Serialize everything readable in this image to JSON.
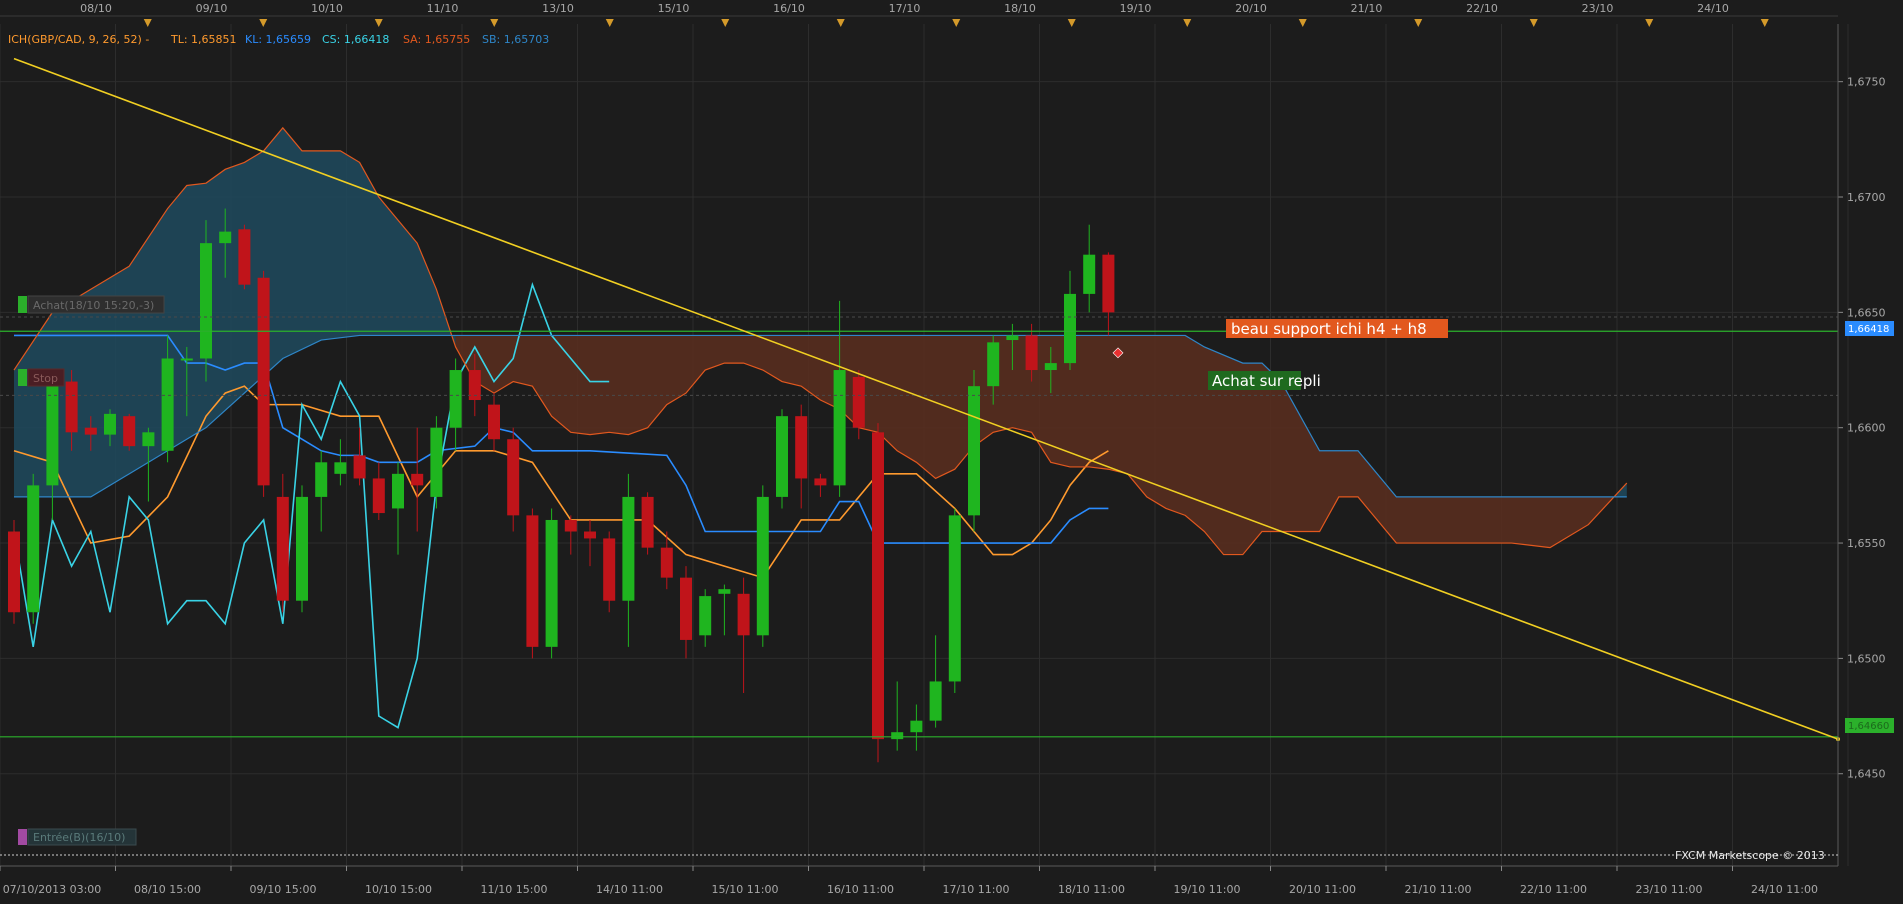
{
  "header": {
    "indicator_name": "ICH(GBP/CAD, 9, 26, 52) -",
    "tl": "TL: 1,65851",
    "kl": "KL: 1,65659",
    "cs": "CS: 1,66418",
    "sa": "SA: 1,65755",
    "sb": "SB: 1,65703"
  },
  "colors": {
    "background": "#1c1c1c",
    "grid": "#2d2d2d",
    "tenkan": "#ff9a2e",
    "kijun": "#2a8cff",
    "chikou": "#39d3e6",
    "senkou_a": "#e2581e",
    "senkou_b": "#2e86c8",
    "kumo_bull": "#1f4a5e",
    "kumo_bear": "#5a2e1e",
    "candle_up": "#1fb51f",
    "candle_down": "#c0141a",
    "trendline": "#f1cf22",
    "support": "#2bb02b"
  },
  "top_dates": [
    "08/10",
    "09/10",
    "10/10",
    "11/10",
    "13/10",
    "15/10",
    "16/10",
    "17/10",
    "18/10",
    "19/10",
    "20/10",
    "21/10",
    "22/10",
    "23/10",
    "24/10"
  ],
  "bottom_dates": [
    "07/10/2013 03:00",
    "08/10 15:00",
    "09/10 15:00",
    "10/10 15:00",
    "11/10 15:00",
    "14/10 11:00",
    "15/10 11:00",
    "16/10 11:00",
    "17/10 11:00",
    "18/10 11:00",
    "19/10 11:00",
    "20/10 11:00",
    "21/10 11:00",
    "22/10 11:00",
    "23/10 11:00",
    "24/10 11:00"
  ],
  "price_labels": [
    "1,6750",
    "1,6700",
    "1,6650",
    "1,6600",
    "1,6550",
    "1,6500",
    "1,6450"
  ],
  "price_tags": {
    "upper": "1,66418",
    "lower": "1,64660"
  },
  "orders": {
    "buy": "Achat(18/10 15:20,-3)",
    "stop": "Stop",
    "entry": "Entrée(B)(16/10)"
  },
  "annotations": {
    "support_note": "beau support ichi h4 + h8",
    "buy_note": "Achat sur repli"
  },
  "copyright": "FXCM Marketscope © 2013",
  "chart_data": {
    "type": "candlestick",
    "title": "ICH(GBP/CAD, 9, 26, 52)",
    "ylim": [
      1.641,
      1.6775
    ],
    "x_range": [
      0,
      99
    ],
    "grid": true,
    "candles": [
      {
        "i": 0,
        "o": 1.6555,
        "h": 1.656,
        "l": 1.6515,
        "c": 1.652
      },
      {
        "i": 1,
        "o": 1.652,
        "h": 1.658,
        "l": 1.6515,
        "c": 1.6575
      },
      {
        "i": 2,
        "o": 1.6575,
        "h": 1.6625,
        "l": 1.656,
        "c": 1.662
      },
      {
        "i": 3,
        "o": 1.662,
        "h": 1.6625,
        "l": 1.659,
        "c": 1.6598
      },
      {
        "i": 4,
        "o": 1.66,
        "h": 1.6605,
        "l": 1.659,
        "c": 1.6597
      },
      {
        "i": 5,
        "o": 1.6597,
        "h": 1.6608,
        "l": 1.6592,
        "c": 1.6606
      },
      {
        "i": 6,
        "o": 1.6605,
        "h": 1.6606,
        "l": 1.659,
        "c": 1.6592
      },
      {
        "i": 7,
        "o": 1.6592,
        "h": 1.66,
        "l": 1.6568,
        "c": 1.6598
      },
      {
        "i": 8,
        "o": 1.659,
        "h": 1.664,
        "l": 1.6585,
        "c": 1.663
      },
      {
        "i": 9,
        "o": 1.663,
        "h": 1.6635,
        "l": 1.6605,
        "c": 1.663
      },
      {
        "i": 10,
        "o": 1.663,
        "h": 1.669,
        "l": 1.662,
        "c": 1.668
      },
      {
        "i": 11,
        "o": 1.668,
        "h": 1.6695,
        "l": 1.6665,
        "c": 1.6685
      },
      {
        "i": 12,
        "o": 1.6686,
        "h": 1.6688,
        "l": 1.666,
        "c": 1.6662
      },
      {
        "i": 13,
        "o": 1.6665,
        "h": 1.6668,
        "l": 1.657,
        "c": 1.6575
      },
      {
        "i": 14,
        "o": 1.657,
        "h": 1.658,
        "l": 1.652,
        "c": 1.6525
      },
      {
        "i": 15,
        "o": 1.6525,
        "h": 1.6575,
        "l": 1.652,
        "c": 1.657
      },
      {
        "i": 16,
        "o": 1.657,
        "h": 1.659,
        "l": 1.6555,
        "c": 1.6585
      },
      {
        "i": 17,
        "o": 1.658,
        "h": 1.6595,
        "l": 1.6575,
        "c": 1.6585
      },
      {
        "i": 18,
        "o": 1.6588,
        "h": 1.66,
        "l": 1.6575,
        "c": 1.6578
      },
      {
        "i": 19,
        "o": 1.6578,
        "h": 1.6585,
        "l": 1.656,
        "c": 1.6563
      },
      {
        "i": 20,
        "o": 1.6565,
        "h": 1.6585,
        "l": 1.6545,
        "c": 1.658
      },
      {
        "i": 21,
        "o": 1.658,
        "h": 1.66,
        "l": 1.6555,
        "c": 1.6575
      },
      {
        "i": 22,
        "o": 1.657,
        "h": 1.6605,
        "l": 1.6565,
        "c": 1.66
      },
      {
        "i": 23,
        "o": 1.66,
        "h": 1.663,
        "l": 1.659,
        "c": 1.6625
      },
      {
        "i": 24,
        "o": 1.6625,
        "h": 1.6632,
        "l": 1.6605,
        "c": 1.6612
      },
      {
        "i": 25,
        "o": 1.661,
        "h": 1.6615,
        "l": 1.659,
        "c": 1.6595
      },
      {
        "i": 26,
        "o": 1.6595,
        "h": 1.66,
        "l": 1.6555,
        "c": 1.6562
      },
      {
        "i": 27,
        "o": 1.6562,
        "h": 1.6565,
        "l": 1.65,
        "c": 1.6505
      },
      {
        "i": 28,
        "o": 1.6505,
        "h": 1.6565,
        "l": 1.65,
        "c": 1.656
      },
      {
        "i": 29,
        "o": 1.656,
        "h": 1.6562,
        "l": 1.6545,
        "c": 1.6555
      },
      {
        "i": 30,
        "o": 1.6555,
        "h": 1.656,
        "l": 1.654,
        "c": 1.6552
      },
      {
        "i": 31,
        "o": 1.6552,
        "h": 1.6555,
        "l": 1.652,
        "c": 1.6525
      },
      {
        "i": 32,
        "o": 1.6525,
        "h": 1.658,
        "l": 1.6505,
        "c": 1.657
      },
      {
        "i": 33,
        "o": 1.657,
        "h": 1.6572,
        "l": 1.6545,
        "c": 1.6548
      },
      {
        "i": 34,
        "o": 1.6548,
        "h": 1.6555,
        "l": 1.653,
        "c": 1.6535
      },
      {
        "i": 35,
        "o": 1.6535,
        "h": 1.654,
        "l": 1.65,
        "c": 1.6508
      },
      {
        "i": 36,
        "o": 1.651,
        "h": 1.653,
        "l": 1.6505,
        "c": 1.6527
      },
      {
        "i": 37,
        "o": 1.6528,
        "h": 1.6532,
        "l": 1.651,
        "c": 1.653
      },
      {
        "i": 38,
        "o": 1.6528,
        "h": 1.6535,
        "l": 1.6485,
        "c": 1.651
      },
      {
        "i": 39,
        "o": 1.651,
        "h": 1.6575,
        "l": 1.6505,
        "c": 1.657
      },
      {
        "i": 40,
        "o": 1.657,
        "h": 1.6608,
        "l": 1.6565,
        "c": 1.6605
      },
      {
        "i": 41,
        "o": 1.6605,
        "h": 1.661,
        "l": 1.6565,
        "c": 1.6578
      },
      {
        "i": 42,
        "o": 1.6578,
        "h": 1.658,
        "l": 1.657,
        "c": 1.6575
      },
      {
        "i": 43,
        "o": 1.6575,
        "h": 1.6655,
        "l": 1.657,
        "c": 1.6625
      },
      {
        "i": 44,
        "o": 1.6622,
        "h": 1.6625,
        "l": 1.6595,
        "c": 1.66
      },
      {
        "i": 45,
        "o": 1.6598,
        "h": 1.6602,
        "l": 1.6455,
        "c": 1.6465
      },
      {
        "i": 46,
        "o": 1.6465,
        "h": 1.649,
        "l": 1.646,
        "c": 1.6468
      },
      {
        "i": 47,
        "o": 1.6468,
        "h": 1.648,
        "l": 1.646,
        "c": 1.6473
      },
      {
        "i": 48,
        "o": 1.6473,
        "h": 1.651,
        "l": 1.647,
        "c": 1.649
      },
      {
        "i": 49,
        "o": 1.649,
        "h": 1.6565,
        "l": 1.6485,
        "c": 1.6562
      },
      {
        "i": 50,
        "o": 1.6562,
        "h": 1.6625,
        "l": 1.6555,
        "c": 1.6618
      },
      {
        "i": 51,
        "o": 1.6618,
        "h": 1.664,
        "l": 1.661,
        "c": 1.6637
      },
      {
        "i": 52,
        "o": 1.6638,
        "h": 1.6645,
        "l": 1.6625,
        "c": 1.664
      },
      {
        "i": 53,
        "o": 1.664,
        "h": 1.6645,
        "l": 1.662,
        "c": 1.6625
      },
      {
        "i": 54,
        "o": 1.6625,
        "h": 1.6635,
        "l": 1.6615,
        "c": 1.6628
      },
      {
        "i": 55,
        "o": 1.6628,
        "h": 1.6668,
        "l": 1.6625,
        "c": 1.6658
      },
      {
        "i": 56,
        "o": 1.6658,
        "h": 1.6688,
        "l": 1.665,
        "c": 1.6675
      },
      {
        "i": 57,
        "o": 1.6675,
        "h": 1.6676,
        "l": 1.664,
        "c": 1.665
      }
    ],
    "series": [
      {
        "key": "tenkan",
        "x": [
          0,
          2,
          4,
          6,
          8,
          10,
          11,
          12,
          13,
          15,
          17,
          19,
          21,
          23,
          25,
          27,
          29,
          31,
          33,
          35,
          37,
          39,
          41,
          43,
          45,
          47,
          49,
          51,
          52,
          53,
          54,
          55,
          56,
          57
        ],
        "y": [
          1.659,
          1.6585,
          1.655,
          1.6553,
          1.657,
          1.6605,
          1.6615,
          1.6618,
          1.661,
          1.661,
          1.6605,
          1.6605,
          1.657,
          1.659,
          1.659,
          1.6585,
          1.656,
          1.656,
          1.656,
          1.6545,
          1.654,
          1.6535,
          1.656,
          1.656,
          1.658,
          1.658,
          1.6565,
          1.6545,
          1.6545,
          1.655,
          1.656,
          1.6575,
          1.6585,
          1.659
        ]
      },
      {
        "key": "kijun",
        "x": [
          0,
          4,
          8,
          9,
          10,
          11,
          12,
          13,
          14,
          15,
          16,
          17,
          18,
          19,
          20,
          21,
          22,
          24,
          25,
          26,
          27,
          28,
          30,
          34,
          35,
          36,
          37,
          38,
          39,
          40,
          42,
          43,
          44,
          45,
          46,
          50,
          54,
          55,
          56,
          57
        ],
        "y": [
          1.664,
          1.664,
          1.664,
          1.6628,
          1.6628,
          1.6625,
          1.6628,
          1.6628,
          1.66,
          1.6595,
          1.659,
          1.6588,
          1.6588,
          1.6585,
          1.6585,
          1.6585,
          1.659,
          1.6592,
          1.66,
          1.6598,
          1.659,
          1.659,
          1.659,
          1.6588,
          1.6575,
          1.6555,
          1.6555,
          1.6555,
          1.6555,
          1.6555,
          1.6555,
          1.6568,
          1.6568,
          1.655,
          1.655,
          1.655,
          1.655,
          1.656,
          1.6565,
          1.6565
        ]
      },
      {
        "key": "chikou",
        "x": [
          0,
          1,
          2,
          3,
          4,
          5,
          6,
          7,
          8,
          9,
          10,
          11,
          12,
          13,
          14,
          15,
          16,
          17,
          18,
          19,
          20,
          21,
          22,
          23,
          24,
          25,
          26,
          27,
          28,
          29,
          30,
          31
        ],
        "y": [
          1.6555,
          1.6505,
          1.656,
          1.654,
          1.6555,
          1.652,
          1.657,
          1.656,
          1.6515,
          1.6525,
          1.6525,
          1.6515,
          1.655,
          1.656,
          1.6515,
          1.661,
          1.6595,
          1.662,
          1.6605,
          1.6475,
          1.647,
          1.65,
          1.6575,
          1.662,
          1.6635,
          1.662,
          1.663,
          1.6662,
          1.664,
          1.663,
          1.662,
          1.662
        ]
      },
      {
        "key": "senkou_a",
        "x": [
          0,
          2,
          4,
          6,
          8,
          9,
          10,
          11,
          12,
          13,
          14,
          15,
          16,
          17,
          18,
          19,
          20,
          21,
          22,
          23,
          24,
          25,
          26,
          27,
          28,
          29,
          30,
          31,
          32,
          33,
          34,
          35,
          36,
          37,
          38,
          39,
          40,
          41,
          42,
          43,
          44,
          45,
          46,
          47,
          48,
          49,
          50,
          51,
          52,
          53,
          54,
          55,
          56,
          57,
          58,
          59,
          60,
          61,
          62,
          63,
          64,
          65,
          66,
          67,
          68,
          69,
          70,
          72,
          74,
          76,
          78,
          80,
          82,
          84
        ],
        "y": [
          1.6625,
          1.665,
          1.666,
          1.667,
          1.6695,
          1.6705,
          1.6706,
          1.6712,
          1.6715,
          1.672,
          1.673,
          1.672,
          1.672,
          1.672,
          1.6715,
          1.67,
          1.669,
          1.668,
          1.666,
          1.6635,
          1.662,
          1.6615,
          1.662,
          1.6618,
          1.6605,
          1.6598,
          1.6597,
          1.6598,
          1.6597,
          1.66,
          1.661,
          1.6615,
          1.6625,
          1.6628,
          1.6628,
          1.6625,
          1.662,
          1.6618,
          1.6612,
          1.6608,
          1.66,
          1.6598,
          1.659,
          1.6585,
          1.6578,
          1.6582,
          1.6592,
          1.6598,
          1.66,
          1.6598,
          1.6585,
          1.6583,
          1.6583,
          1.6582,
          1.658,
          1.657,
          1.6565,
          1.6562,
          1.6555,
          1.6545,
          1.6545,
          1.6555,
          1.6555,
          1.6555,
          1.6555,
          1.657,
          1.657,
          1.655,
          1.655,
          1.655,
          1.655,
          1.6548,
          1.6558,
          1.6576
        ]
      },
      {
        "key": "senkou_b",
        "x": [
          0,
          2,
          4,
          6,
          8,
          10,
          12,
          14,
          16,
          18,
          20,
          22,
          24,
          26,
          28,
          30,
          32,
          34,
          36,
          38,
          40,
          42,
          44,
          46,
          48,
          50,
          52,
          54,
          56,
          58,
          59,
          60,
          61,
          62,
          64,
          65,
          66,
          67,
          68,
          70,
          72,
          74,
          76,
          78,
          80,
          82,
          84
        ],
        "y": [
          1.657,
          1.657,
          1.657,
          1.658,
          1.659,
          1.66,
          1.6615,
          1.663,
          1.6638,
          1.664,
          1.664,
          1.664,
          1.664,
          1.664,
          1.664,
          1.664,
          1.664,
          1.664,
          1.664,
          1.664,
          1.664,
          1.664,
          1.664,
          1.664,
          1.664,
          1.664,
          1.664,
          1.664,
          1.664,
          1.664,
          1.664,
          1.664,
          1.664,
          1.6635,
          1.6628,
          1.6628,
          1.662,
          1.6605,
          1.659,
          1.659,
          1.657,
          1.657,
          1.657,
          1.657,
          1.657,
          1.657,
          1.657
        ]
      }
    ],
    "trendline": [
      {
        "x": 0,
        "y": 1.676
      },
      {
        "x": 95,
        "y": 1.6465
      }
    ],
    "support_levels": [
      1.66418,
      1.6466
    ]
  }
}
